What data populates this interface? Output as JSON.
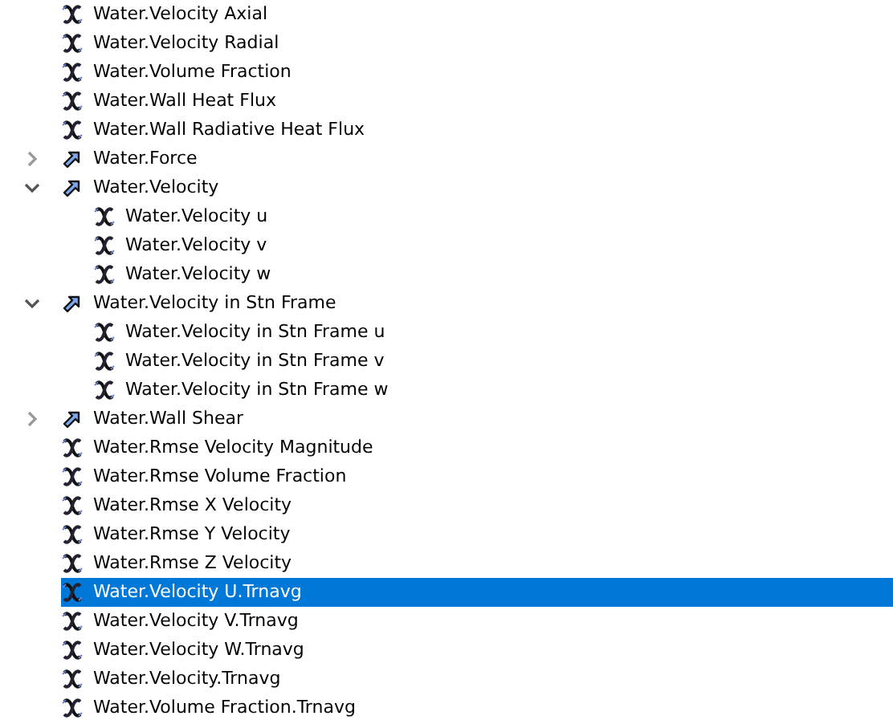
{
  "tree": [
    {
      "label": "Water.Velocity Axial",
      "kind": "scalar",
      "selected": false
    },
    {
      "label": "Water.Velocity Radial",
      "kind": "scalar",
      "selected": false
    },
    {
      "label": "Water.Volume Fraction",
      "kind": "scalar",
      "selected": false
    },
    {
      "label": "Water.Wall Heat Flux",
      "kind": "scalar",
      "selected": false
    },
    {
      "label": "Water.Wall Radiative Heat Flux",
      "kind": "scalar",
      "selected": false
    },
    {
      "label": "Water.Force",
      "kind": "vector",
      "expanded": false,
      "selected": false
    },
    {
      "label": "Water.Velocity",
      "kind": "vector",
      "expanded": true,
      "selected": false,
      "children": [
        {
          "label": "Water.Velocity u",
          "kind": "scalar",
          "selected": false
        },
        {
          "label": "Water.Velocity v",
          "kind": "scalar",
          "selected": false
        },
        {
          "label": "Water.Velocity w",
          "kind": "scalar",
          "selected": false
        }
      ]
    },
    {
      "label": "Water.Velocity in Stn Frame",
      "kind": "vector",
      "expanded": true,
      "selected": false,
      "children": [
        {
          "label": "Water.Velocity in Stn Frame u",
          "kind": "scalar",
          "selected": false
        },
        {
          "label": "Water.Velocity in Stn Frame v",
          "kind": "scalar",
          "selected": false
        },
        {
          "label": "Water.Velocity in Stn Frame w",
          "kind": "scalar",
          "selected": false
        }
      ]
    },
    {
      "label": "Water.Wall Shear",
      "kind": "vector",
      "expanded": false,
      "selected": false
    },
    {
      "label": "Water.Rmse Velocity Magnitude",
      "kind": "scalar",
      "selected": false
    },
    {
      "label": "Water.Rmse Volume Fraction",
      "kind": "scalar",
      "selected": false
    },
    {
      "label": "Water.Rmse X Velocity",
      "kind": "scalar",
      "selected": false
    },
    {
      "label": "Water.Rmse Y Velocity",
      "kind": "scalar",
      "selected": false
    },
    {
      "label": "Water.Rmse Z Velocity",
      "kind": "scalar",
      "selected": false
    },
    {
      "label": "Water.Velocity U.Trnavg",
      "kind": "scalar",
      "selected": true
    },
    {
      "label": "Water.Velocity V.Trnavg",
      "kind": "scalar",
      "selected": false
    },
    {
      "label": "Water.Velocity W.Trnavg",
      "kind": "scalar",
      "selected": false
    },
    {
      "label": "Water.Velocity.Trnavg",
      "kind": "scalar",
      "selected": false
    },
    {
      "label": "Water.Volume Fraction.Trnavg",
      "kind": "scalar",
      "selected": false
    }
  ]
}
